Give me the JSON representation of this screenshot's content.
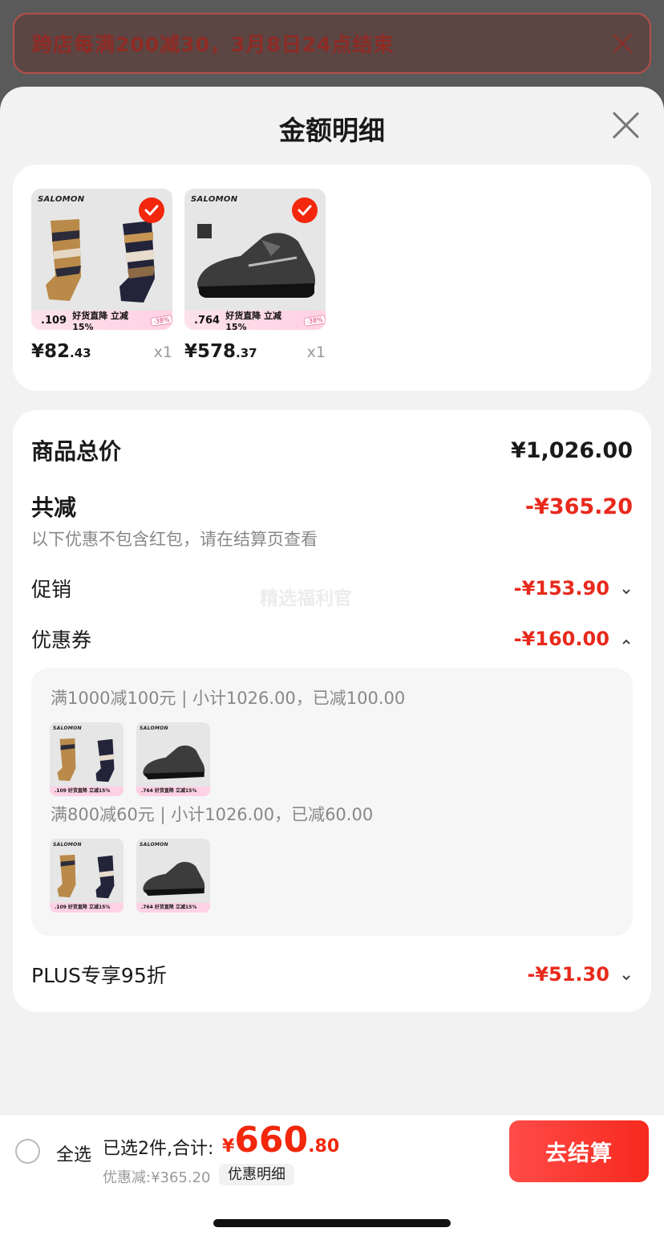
{
  "promo_banner": {
    "text": "跨店每满200减30，3月8日24点结束"
  },
  "sheet": {
    "title": "金额明细"
  },
  "products": [
    {
      "brand": "SALOMON",
      "price_int": "¥82",
      "price_dec": ".43",
      "qty": "x1",
      "strip_num": ".109",
      "strip_text": "好货直降 立减15%",
      "strip_tag": "-38%"
    },
    {
      "brand": "SALOMON",
      "price_int": "¥578",
      "price_dec": ".37",
      "qty": "x1",
      "strip_num": ".764",
      "strip_text": "好货直降 立减15%",
      "strip_tag": "-38%"
    }
  ],
  "summary": {
    "goods_total_label": "商品总价",
    "goods_total_value": "¥1,026.00",
    "reduction_label": "共减",
    "reduction_value": "-¥365.20",
    "reduction_note": "以下优惠不包含红包，请在结算页查看",
    "promo_label": "促销",
    "promo_value": "-¥153.90",
    "coupon_label": "优惠券",
    "coupon_value": "-¥160.00",
    "plus_label": "PLUS专享95折",
    "plus_value": "-¥51.30",
    "watermark": "精选福利官"
  },
  "coupons": [
    {
      "line": "满1000减100元 | 小计1026.00，已减100.00"
    },
    {
      "line": "满800减60元 | 小计1026.00，已减60.00"
    }
  ],
  "mini_items": [
    {
      "brand": "SALOMON",
      "strip": ".109  好货直降 立减15%"
    },
    {
      "brand": "SALOMON",
      "strip": ".764  好货直降 立减15%"
    }
  ],
  "bottom_bar": {
    "select_all": "全选",
    "selected": "已选2件,合计:",
    "total_yen": "¥",
    "total_int": "660",
    "total_dec": ".80",
    "discount": "优惠减:¥365.20",
    "detail_chip": "优惠明细",
    "checkout": "去结算"
  },
  "colors": {
    "accent_red": "#f2270c",
    "price_red": "#e8291c"
  }
}
